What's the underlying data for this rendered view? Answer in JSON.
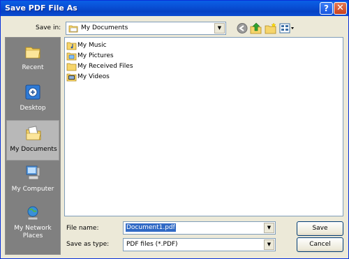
{
  "window": {
    "title": "Save PDF File As",
    "help_glyph": "?",
    "close_glyph": "✕"
  },
  "toolbar": {
    "save_in_label": "Save in:",
    "save_in_value": "My Documents",
    "dropdown_glyph": "▼",
    "icons": [
      "back-icon",
      "up-folder-icon",
      "new-folder-icon",
      "view-menu-icon"
    ]
  },
  "places": [
    {
      "label": "Recent",
      "icon": "recent-icon",
      "selected": false
    },
    {
      "label": "Desktop",
      "icon": "desktop-icon",
      "selected": false
    },
    {
      "label": "My Documents",
      "icon": "my-documents-icon",
      "selected": true
    },
    {
      "label": "My Computer",
      "icon": "my-computer-icon",
      "selected": false
    },
    {
      "label": "My Network Places",
      "icon": "network-places-icon",
      "selected": false
    }
  ],
  "files": [
    {
      "name": "My Music",
      "icon": "music-folder-icon"
    },
    {
      "name": "My Pictures",
      "icon": "pictures-folder-icon"
    },
    {
      "name": "My Received Files",
      "icon": "folder-icon"
    },
    {
      "name": "My Videos",
      "icon": "videos-folder-icon"
    }
  ],
  "form": {
    "file_name_label": "File name:",
    "file_name_value": "Document1.pdf",
    "save_as_type_label": "Save as type:",
    "save_as_type_value": "PDF files (*.PDF)"
  },
  "buttons": {
    "save": "Save",
    "cancel": "Cancel"
  },
  "colors": {
    "titlebar": "#0a5fe6",
    "dialog_bg": "#ece9d8",
    "places_bg": "#808080",
    "selection": "#316ac5"
  }
}
